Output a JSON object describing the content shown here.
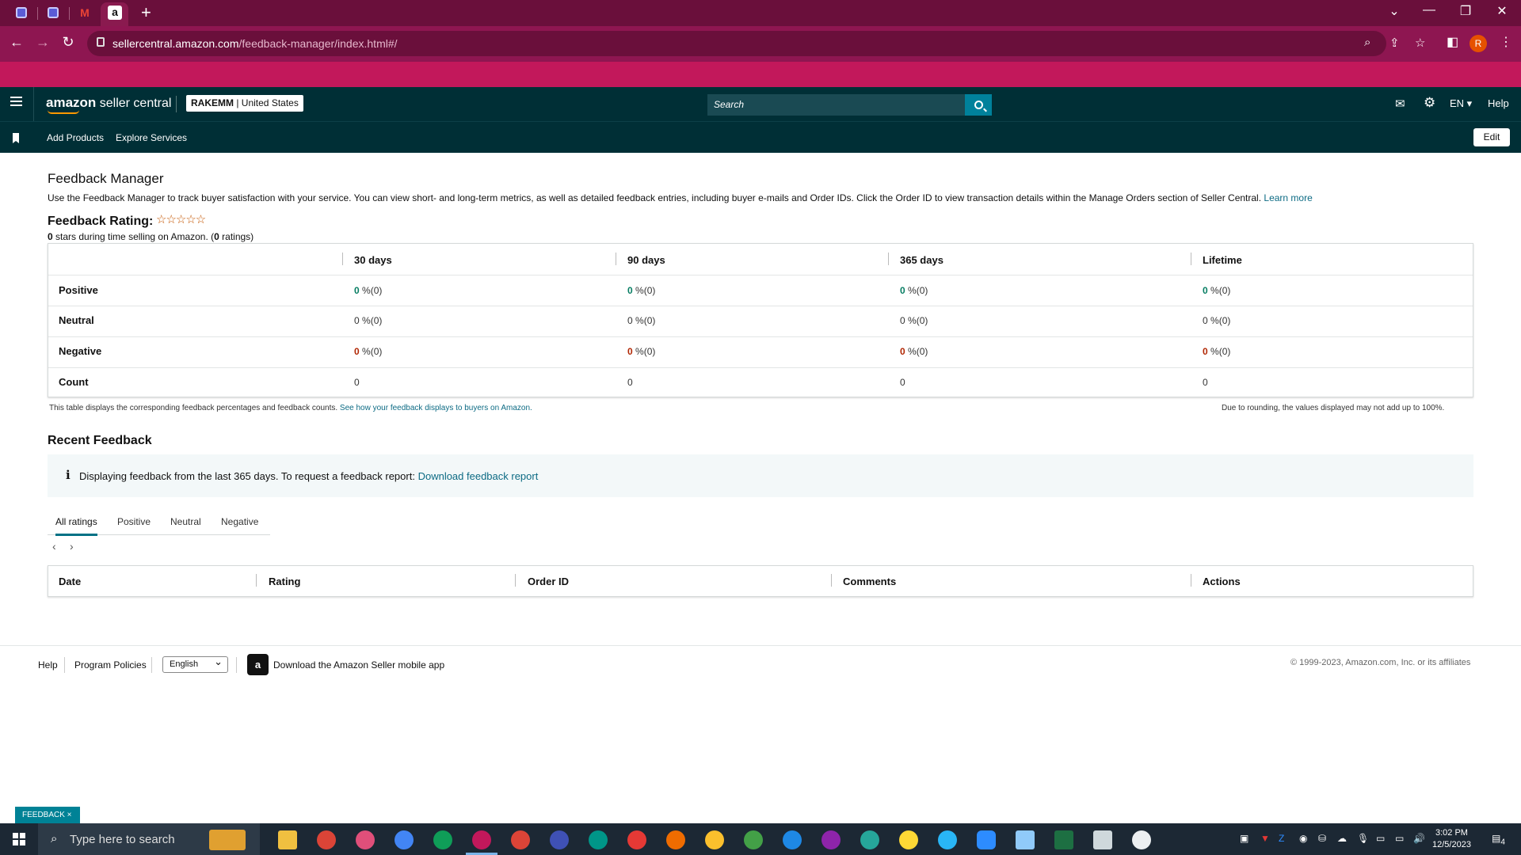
{
  "browser": {
    "url_host": "sellercentral.amazon.com",
    "url_path": "/feedback-manager/index.html#/",
    "profile_initial": "R"
  },
  "header": {
    "logo_a": "amazon",
    "logo_b": "seller central",
    "account_name": "RAKEMM",
    "account_region": "| United States",
    "search_placeholder": "Search",
    "lang": "EN",
    "help": "Help"
  },
  "subnav": {
    "items": [
      "Add Products",
      "Explore Services"
    ],
    "edit": "Edit"
  },
  "page": {
    "title": "Feedback Manager",
    "intro": "Use the Feedback Manager to track buyer satisfaction with your service. You can view short- and long-term metrics, as well as detailed feedback entries, including buyer e-mails and Order IDs. Click the Order ID to view transaction details within the Manage Orders section of Seller Central.",
    "learn_more": "Learn more",
    "rating_label": "Feedback Rating:",
    "stars": "☆☆☆☆☆",
    "stars_value": "0",
    "stars_mid": "stars during time selling on Amazon. (",
    "stars_count": "0",
    "stars_end": "ratings)"
  },
  "feedback_table": {
    "columns": [
      "30 days",
      "90 days",
      "365 days",
      "Lifetime"
    ],
    "rows": [
      {
        "label": "Positive",
        "cells": [
          {
            "v": "0",
            "s": "%(0)"
          },
          {
            "v": "0",
            "s": "%(0)"
          },
          {
            "v": "0",
            "s": "%(0)"
          },
          {
            "v": "0",
            "s": "%(0)"
          }
        ]
      },
      {
        "label": "Neutral",
        "cells": [
          {
            "v": "0",
            "s": "%(0)"
          },
          {
            "v": "0",
            "s": "%(0)"
          },
          {
            "v": "0",
            "s": "%(0)"
          },
          {
            "v": "0",
            "s": "%(0)"
          }
        ]
      },
      {
        "label": "Negative",
        "cells": [
          {
            "v": "0",
            "s": "%(0)"
          },
          {
            "v": "0",
            "s": "%(0)"
          },
          {
            "v": "0",
            "s": "%(0)"
          },
          {
            "v": "0",
            "s": "%(0)"
          }
        ]
      },
      {
        "label": "Count",
        "cells": [
          {
            "v": "0",
            "s": ""
          },
          {
            "v": "0",
            "s": ""
          },
          {
            "v": "0",
            "s": ""
          },
          {
            "v": "0",
            "s": ""
          }
        ]
      }
    ],
    "note": "This table displays the corresponding feedback percentages and feedback counts.",
    "note_link": "See how your feedback displays to buyers on Amazon.",
    "rounding_note": "Due to rounding, the values displayed may not add up to 100%."
  },
  "recent": {
    "title": "Recent Feedback",
    "info_icon": "i",
    "info_text": "Displaying feedback from the last 365 days. To request a feedback report:",
    "info_link": "Download feedback report",
    "tabs": [
      "All ratings",
      "Positive",
      "Neutral",
      "Negative"
    ],
    "pager_prev": "‹",
    "pager_next": "›",
    "columns": [
      "Date",
      "Rating",
      "Order ID",
      "Comments",
      "Actions"
    ]
  },
  "footer": {
    "help": "Help",
    "policies": "Program Policies",
    "language": "English",
    "app_text": "Download the Amazon Seller mobile app",
    "copyright": "© 1999-2023, Amazon.com, Inc. or its affiliates"
  },
  "feedback_tag": "FEEDBACK ×",
  "taskbar": {
    "search_placeholder": "Type here to search",
    "time": "3:02 PM",
    "date": "12/5/2023",
    "notifications": "4"
  },
  "colors": {
    "seller_header": "#002f36",
    "accent": "#007185",
    "positive": "#067d62",
    "negative": "#b12704",
    "browser_frame": "#c2185b"
  }
}
